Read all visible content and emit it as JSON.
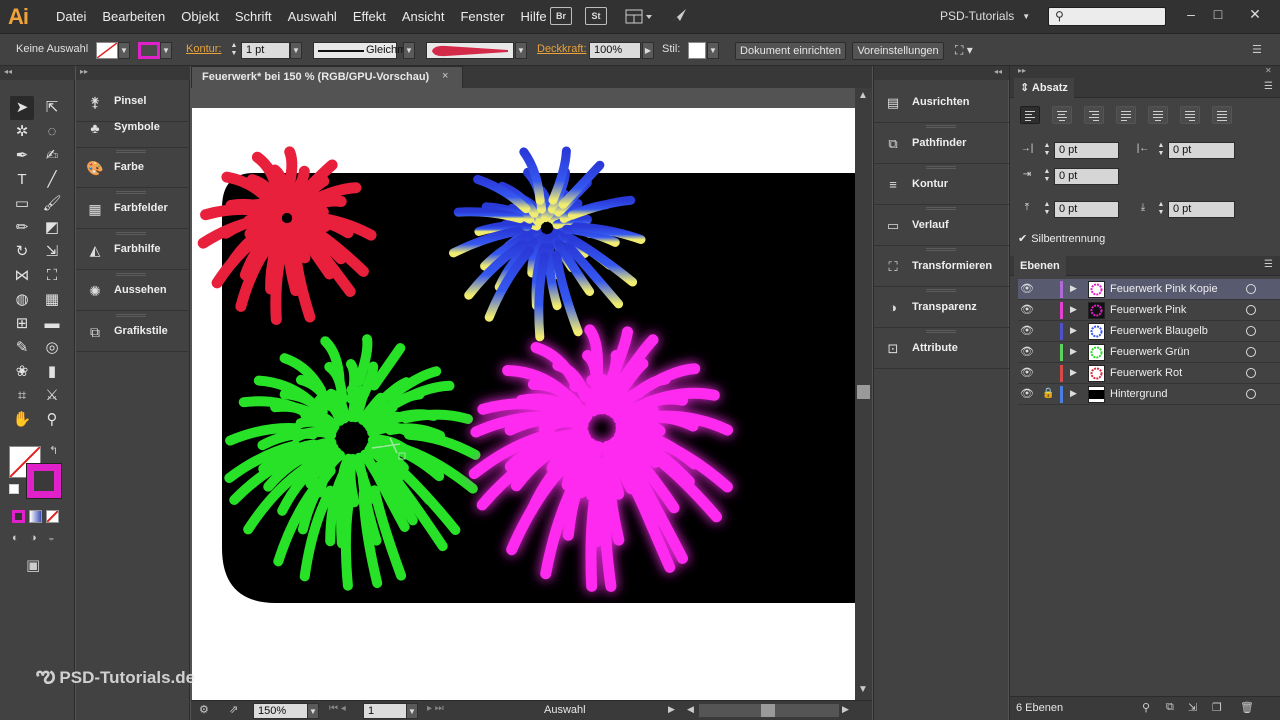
{
  "app": {
    "logo": "Ai",
    "workspace": "PSD-Tutorials",
    "search_placeholder": ""
  },
  "menu": [
    "Datei",
    "Bearbeiten",
    "Objekt",
    "Schrift",
    "Auswahl",
    "Effekt",
    "Ansicht",
    "Fenster",
    "Hilfe"
  ],
  "topicons": {
    "bridge": "Br",
    "stock": "St"
  },
  "control": {
    "selection": "Keine Auswahl",
    "kontur_label": "Kontur:",
    "stroke_weight": "1 pt",
    "stroke_style": "Gleichm.",
    "opacity_label": "Deckkraft:",
    "opacity": "100%",
    "style_label": "Stil:",
    "doc_setup": "Dokument einrichten",
    "preferences": "Voreinstellungen",
    "colors": {
      "fill": "#ffffff",
      "stroke": "#e020c8"
    }
  },
  "left_dock": [
    {
      "label": "Pinsel",
      "icon": "brush-icon"
    },
    {
      "label": "Symbole",
      "icon": "symbols-icon"
    },
    {
      "label": "Farbe",
      "icon": "color-palette-icon"
    },
    {
      "label": "Farbfelder",
      "icon": "swatches-icon"
    },
    {
      "label": "Farbhilfe",
      "icon": "color-guide-icon"
    },
    {
      "label": "Aussehen",
      "icon": "appearance-icon"
    },
    {
      "label": "Grafikstile",
      "icon": "graphic-styles-icon"
    }
  ],
  "document": {
    "tab_title": "Feuerwerk* bei 150 % (RGB/GPU-Vorschau)",
    "close": "×"
  },
  "statusbar": {
    "zoom": "150%",
    "artboard": "1",
    "tool": "Auswahl"
  },
  "right_dock": [
    {
      "label": "Ausrichten",
      "icon": "align-icon"
    },
    {
      "label": "Pathfinder",
      "icon": "pathfinder-icon"
    },
    {
      "label": "Kontur",
      "icon": "stroke-icon"
    },
    {
      "label": "Verlauf",
      "icon": "gradient-icon"
    },
    {
      "label": "Transformieren",
      "icon": "transform-icon"
    },
    {
      "label": "Transparenz",
      "icon": "transparency-icon"
    },
    {
      "label": "Attribute",
      "icon": "attributes-icon"
    }
  ],
  "absatz": {
    "title": "Absatz",
    "left_indent": "0 pt",
    "right_indent": "0 pt",
    "first_line_indent": "0 pt",
    "space_before": "0 pt",
    "space_after": "0 pt",
    "hyphenation": "Silbentrennung"
  },
  "ebenen": {
    "title": "Ebenen",
    "count": "6 Ebenen",
    "layers": [
      {
        "name": "Feuerwerk Pink Kopie",
        "color": "#b06ad8",
        "selected": true
      },
      {
        "name": "Feuerwerk Pink",
        "color": "#e43fd0",
        "selected": false
      },
      {
        "name": "Feuerwerk Blaugelb",
        "color": "#5050c8",
        "selected": false
      },
      {
        "name": "Feuerwerk Grün",
        "color": "#5cd25c",
        "selected": false
      },
      {
        "name": "Feuerwerk Rot",
        "color": "#d84a4a",
        "selected": false
      },
      {
        "name": "Hintergrund",
        "color": "#4a7ee0",
        "selected": false
      }
    ]
  },
  "watermark": "PSD-Tutorials.de"
}
